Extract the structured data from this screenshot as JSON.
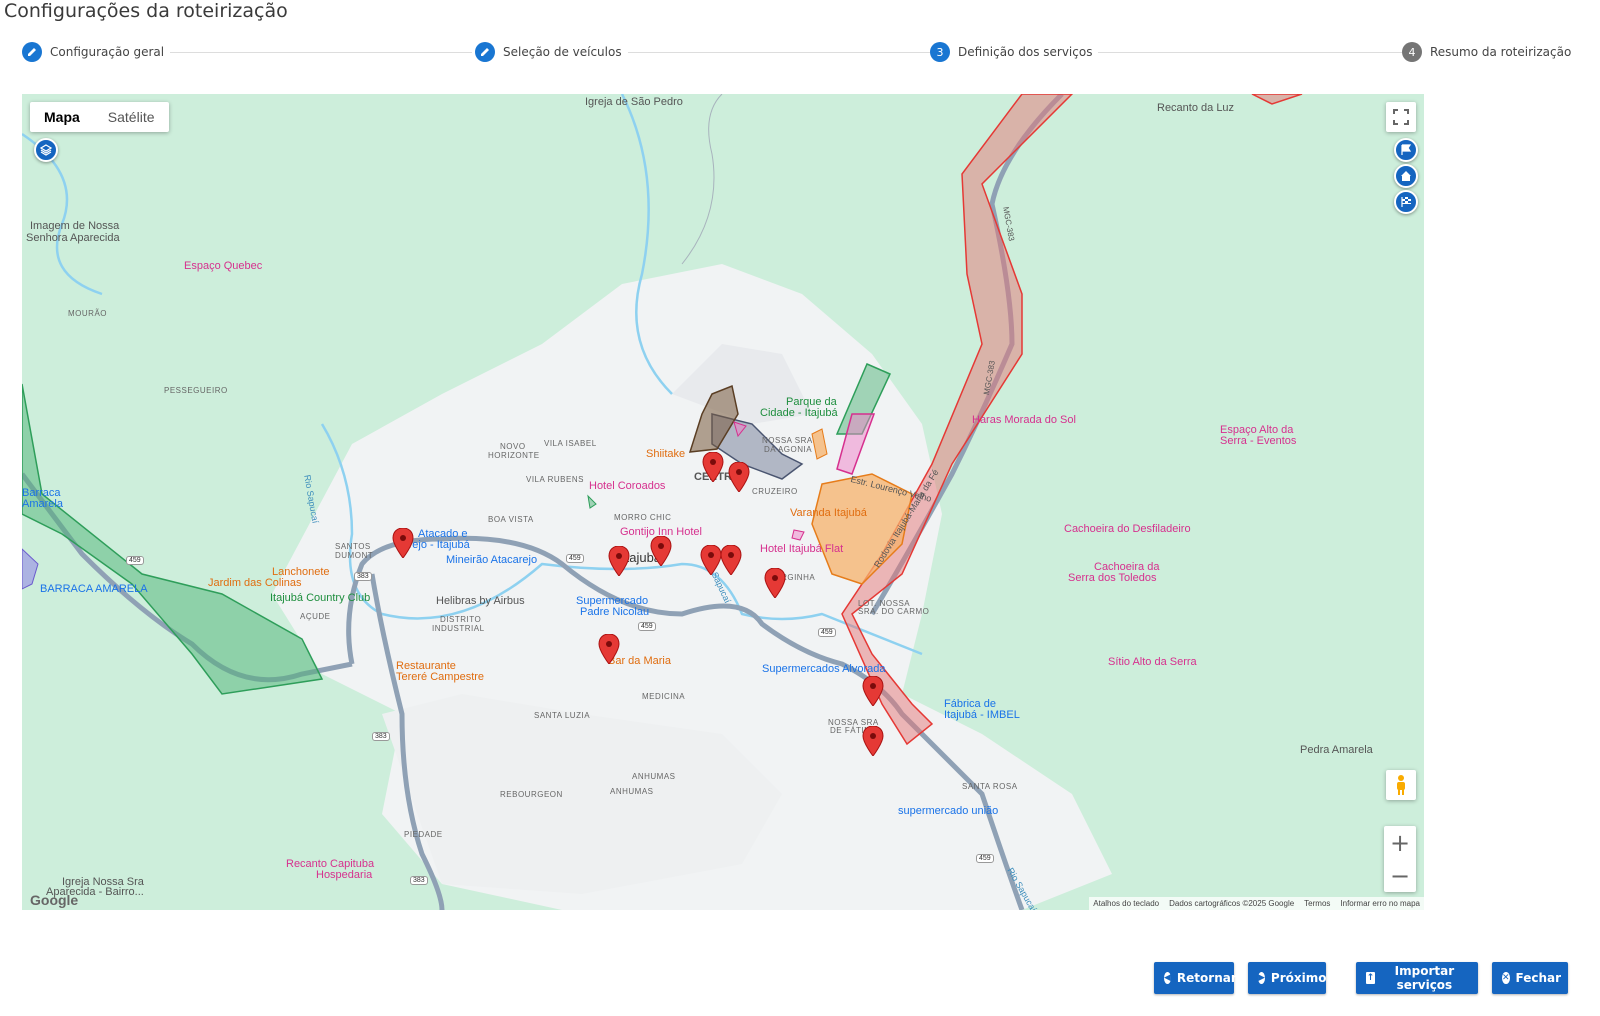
{
  "title": "Configurações da roteirização",
  "steps": [
    {
      "label": "Configuração geral",
      "state": "done",
      "icon": "pencil-icon"
    },
    {
      "label": "Seleção de veículos",
      "state": "done",
      "icon": "pencil-icon"
    },
    {
      "label": "Definição dos serviços",
      "state": "active",
      "number": "3"
    },
    {
      "label": "Resumo da roteirização",
      "state": "todo",
      "number": "4"
    }
  ],
  "map": {
    "type_buttons": {
      "map": "Mapa",
      "satellite": "Satélite"
    },
    "labels": {
      "igreja_sao_pedro": "Igreja de São Pedro",
      "recanto_luz": "Recanto da Luz",
      "imagem_nossa_senhora_1": "Imagem de Nossa",
      "imagem_nossa_senhora_2": "Senhora Aparecida",
      "espaco_quebec": "Espaço Quebec",
      "mourao": "MOURÃO",
      "pesseguiero": "PESSEGUEIRO",
      "vila_isabel": "VILA ISABEL",
      "novo_horizonte_1": "NOVO",
      "novo_horizonte_2": "HORIZONTE",
      "vila_rubens": "VILA RUBENS",
      "boa_vista": "BOA VISTA",
      "morro_chic": "MORRO CHIC",
      "shiitake": "Shiitake",
      "centro": "CENTRO",
      "cruzeiro": "CRUZEIRO",
      "hotel_coroados": "Hotel Coroados",
      "gontijo": "Gontijo Inn Hotel",
      "varanda": "Varanda Itajubá",
      "hotel_flat": "Hotel Itajubá Flat",
      "parque_1": "Parque da",
      "parque_2": "Cidade - Itajubá",
      "nossa_sra_agonia_1": "NOSSA SRA",
      "nossa_sra_agonia_2": "DA AGONIA",
      "haras": "Haras Morada do Sol",
      "espaco_alto_1": "Espaço Alto da",
      "espaco_alto_2": "Serra - Eventos",
      "cachoeira_desf": "Cachoeira do Desfiladeiro",
      "cachoeira_serra_1": "Cachoeira da",
      "cachoeira_serra_2": "Serra dos Toledos",
      "sitio": "Sítio Alto da Serra",
      "pedra_amarela": "Pedra Amarela",
      "atacado_1": "Atacado e",
      "atacado_2": "Varejo - Itajubá",
      "mineirao": "Mineirão Atacarejo",
      "santos_dumont_1": "SANTOS",
      "santos_dumont_2": "DUMONT",
      "itajuba": "Itajubá",
      "lanchonete_1": "Lanchonete",
      "lanchonete_2": "Jardim das Colinas",
      "country_club": "Itajubá Country Club",
      "helibras": "Helibras by Airbus",
      "acude": "AÇUDE",
      "distrito_1": "DISTRITO",
      "distrito_2": "INDUSTRIAL",
      "barraca": "BARRACA AMARELA",
      "barraca_left_1": "Barraca",
      "barraca_left_2": "Amarela",
      "supermercado_padre_1": "Supermercado",
      "supermercado_padre_2": "Padre Nicolau",
      "bar_maria": "Bar da Maria",
      "restaurante_1": "Restaurante",
      "restaurante_2": "Tereré Campestre",
      "medicina": "MEDICINA",
      "santa_luzia": "SANTA LUZIA",
      "varginha": "VARGINHA",
      "lot_nossa_1": "LOT. NOSSA",
      "lot_nossa_2": "SRA. DO CARMO",
      "supermercados_alvorada": "Supermercados Alvorada",
      "fabrica_1": "Fábrica de",
      "fabrica_2": "Itajubá - IMBEL",
      "nossa_fatima_1": "NOSSA SRA",
      "nossa_fatima_2": "DE FÁTIMA",
      "anhumas_1": "ANHUMAS",
      "anhumas_2": "ANHUMAS",
      "rebourgeon": "REBOURGEON",
      "santa_rosa": "SANTA ROSA",
      "supermercado_uniao": "supermercado união",
      "piedade": "PIEDADE",
      "recanto_capituba_1": "Recanto Capituba",
      "recanto_capituba_2": "Hospedaria",
      "igreja_aparecida_1": "Igreja Nossa Sra",
      "igreja_aparecida_2": "Aparecida - Bairro...",
      "rio_sapucai_1": "Rio Sapucaí",
      "rio_sapucai_2": "Rio Sapucaí",
      "rio_sapucai_3": "Rio Sapucaí",
      "rodovia": "Rodovia Itajubá-Maria da Fé",
      "estrada_lourenco": "Estr. Lourenço Velho",
      "mgc_383": "MGC-383",
      "mgc_383b": "MGC-383",
      "r459a": "459",
      "r459b": "459",
      "r459c": "459",
      "r459d": "459",
      "r459e": "459",
      "r383a": "383",
      "r383b": "383",
      "r383c": "383"
    },
    "attribution": [
      "Atalhos do teclado",
      "Dados cartográficos ©2025 Google",
      "Termos",
      "Informar erro no mapa"
    ],
    "google": "Google",
    "zoom_in": "+",
    "zoom_out": "−",
    "marker_count": 13
  },
  "buttons": {
    "back": "Retornar",
    "next": "Próximo",
    "import": "Importar serviços",
    "close": "Fechar"
  },
  "colors": {
    "primary": "#1565c0",
    "map_bg": "#cdeedb",
    "marker": "#e53935",
    "zone_red": "#f28b8b",
    "zone_orange": "#f6b26b",
    "zone_green": "#7fcf9c"
  }
}
